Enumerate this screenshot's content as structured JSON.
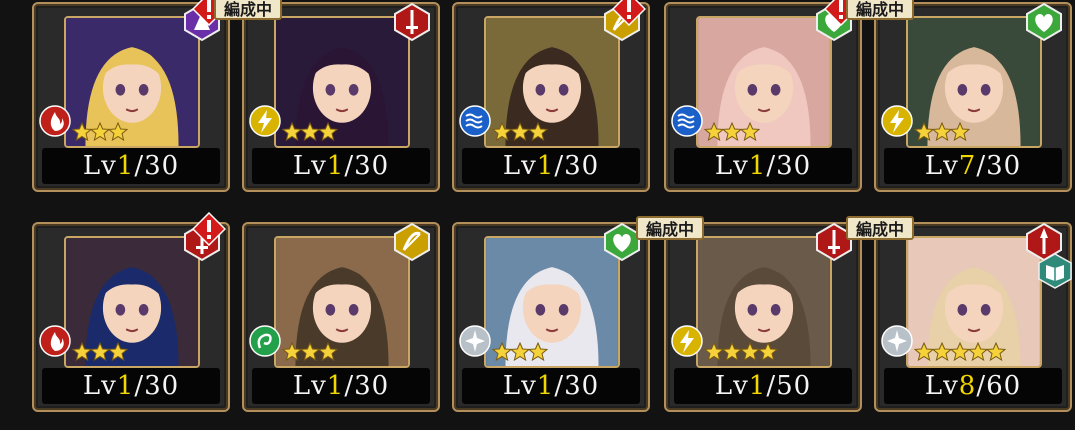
{
  "badge_text": "編成中",
  "units": [
    {
      "lv_prefix": "Lv",
      "level": "1",
      "max": "/30",
      "class": "mage",
      "element": "fire",
      "stars": 3,
      "bg": "#3a2a6a",
      "hair": "#e8c35a",
      "alert": true,
      "formation": false
    },
    {
      "lv_prefix": "Lv",
      "level": "1",
      "max": "/30",
      "class": "sword",
      "element": "thunder",
      "stars": 3,
      "bg": "#2a1a3a",
      "hair": "#2b1535",
      "alert": false,
      "formation": true
    },
    {
      "lv_prefix": "Lv",
      "level": "1",
      "max": "/30",
      "class": "bow",
      "element": "water",
      "stars": 3,
      "bg": "#7a6a3a",
      "hair": "#3a2a20",
      "alert": true,
      "formation": false
    },
    {
      "lv_prefix": "Lv",
      "level": "1",
      "max": "/30",
      "class": "heal",
      "element": "water",
      "stars": 3,
      "bg": "#d8a8a0",
      "hair": "#f0c8c0",
      "alert": true,
      "formation": false
    },
    {
      "lv_prefix": "Lv",
      "level": "7",
      "max": "/30",
      "class": "heal",
      "element": "thunder",
      "stars": 3,
      "bg": "#3a4a3a",
      "hair": "#d8b89a",
      "alert": false,
      "formation": true
    },
    {
      "lv_prefix": "Lv",
      "level": "1",
      "max": "/30",
      "class": "sword",
      "element": "fire",
      "stars": 3,
      "bg": "#3a2a3a",
      "hair": "#1a2a6a",
      "alert": true,
      "formation": false
    },
    {
      "lv_prefix": "Lv",
      "level": "1",
      "max": "/30",
      "class": "bow",
      "element": "wind",
      "stars": 3,
      "bg": "#8a6a4a",
      "hair": "#4a3a2a",
      "alert": false,
      "formation": false
    },
    {
      "lv_prefix": "Lv",
      "level": "1",
      "max": "/30",
      "class": "heal",
      "element": "light",
      "stars": 3,
      "bg": "#6a8aa8",
      "hair": "#e8e8ee",
      "alert": false,
      "formation": false
    },
    {
      "lv_prefix": "Lv",
      "level": "1",
      "max": "/50",
      "class": "sword",
      "element": "thunder",
      "stars": 4,
      "bg": "#6a5a4a",
      "hair": "#5a4a3a",
      "alert": false,
      "formation": true
    },
    {
      "lv_prefix": "Lv",
      "level": "8",
      "max": "/60",
      "class": "lance",
      "element": "light",
      "stars": 5,
      "bg": "#e8c8b8",
      "hair": "#e8d0a8",
      "alert": false,
      "formation": true,
      "book": true
    }
  ],
  "colors": {
    "gold": "#b3905b",
    "level_highlight": "#f2d600",
    "alert_red": "#d21a1a",
    "mage_purple": "#6a2ea8",
    "sword_red": "#b01818",
    "bow_gold": "#c9a000",
    "heal_green": "#3ca83c"
  }
}
